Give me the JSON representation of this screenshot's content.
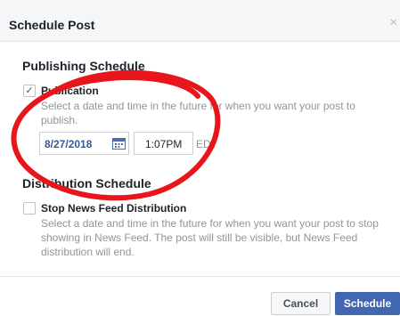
{
  "dialog": {
    "title": "Schedule Post",
    "close_glyph": "×"
  },
  "publishing": {
    "section_title": "Publishing Schedule",
    "checkbox_checked": true,
    "check_glyph": "✓",
    "option_label": "Publication",
    "description": "Select a date and time in the future for when you want your post to publish.",
    "date_value": "8/27/2018",
    "time_value": "1:07PM",
    "timezone": "EDT"
  },
  "distribution": {
    "section_title": "Distribution Schedule",
    "checkbox_checked": false,
    "option_label": "Stop News Feed Distribution",
    "description": "Select a date and time in the future for when you want your post to stop showing in News Feed. The post will still be visible, but News Feed distribution will end."
  },
  "footer": {
    "cancel_label": "Cancel",
    "schedule_label": "Schedule"
  },
  "colors": {
    "primary_button": "#4267b2",
    "link_blue": "#365899",
    "annotation_red": "#e8151b"
  },
  "icons": [
    "close-icon",
    "checkmark-icon",
    "calendar-icon"
  ]
}
